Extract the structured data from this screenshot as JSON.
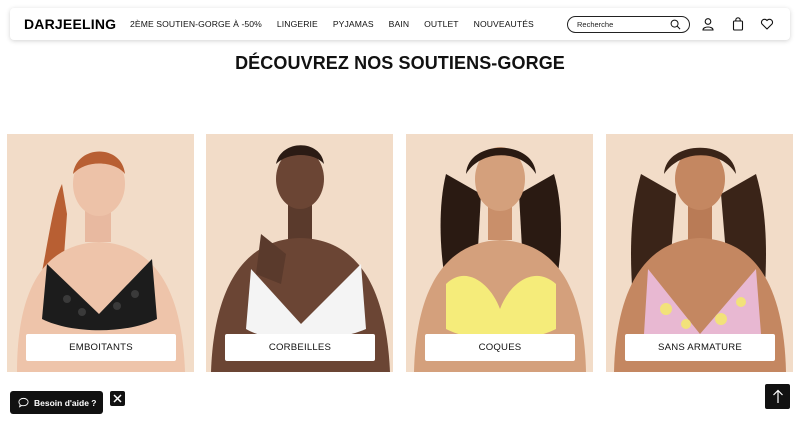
{
  "header": {
    "logo": "DARJEELING",
    "nav": [
      {
        "label": "2ème soutien-gorge à -50%"
      },
      {
        "label": "Lingerie"
      },
      {
        "label": "Pyjamas"
      },
      {
        "label": "Bain"
      },
      {
        "label": "Outlet"
      },
      {
        "label": "Nouveautés"
      }
    ],
    "search": {
      "placeholder": "Recherche"
    },
    "icons": [
      "search-icon",
      "user-icon",
      "bag-icon",
      "heart-icon"
    ]
  },
  "main": {
    "title": "DÉCOUVREZ NOS SOUTIENS-GORGE",
    "categories": [
      {
        "label": "Emboitants"
      },
      {
        "label": "Corbeilles"
      },
      {
        "label": "Coques"
      },
      {
        "label": "Sans armature"
      }
    ]
  },
  "widgets": {
    "help_label": "Besoin d'aide ?"
  },
  "colors": {
    "card_background": "#f2dcc8",
    "text": "#111111",
    "button_dark": "#111111"
  }
}
